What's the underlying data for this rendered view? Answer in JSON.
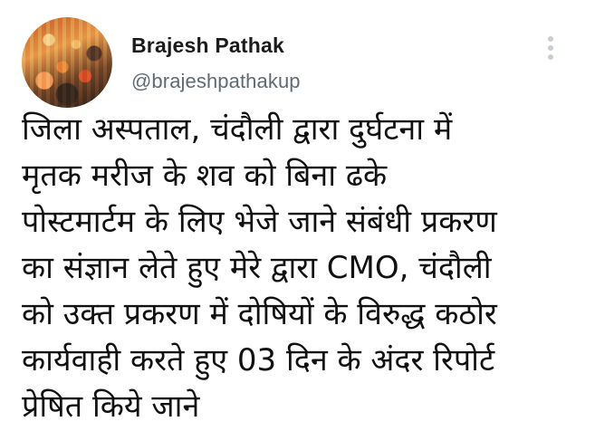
{
  "tweet": {
    "author": {
      "display_name": "Brajesh Pathak",
      "handle": "@brajeshpathakup",
      "avatar_icon": "profile-photo"
    },
    "more_icon": "more-options-icon",
    "text_lines": [
      "जिला अस्पताल, चंदौली द्वारा दुर्घटना में",
      "मृतक मरीज के शव को बिना ढके",
      "पोस्टमार्टम के लिए भेजे जाने संबंधी प्रकरण",
      "का संज्ञान लेते हुए मेरे द्वारा CMO, चंदौली",
      "को उक्त प्रकरण में दोषियों के विरुद्ध कठोर",
      "कार्यवाही करते हुए 03 दिन के अंदर रिपोर्ट",
      "प्रेषित किये जाने"
    ]
  }
}
